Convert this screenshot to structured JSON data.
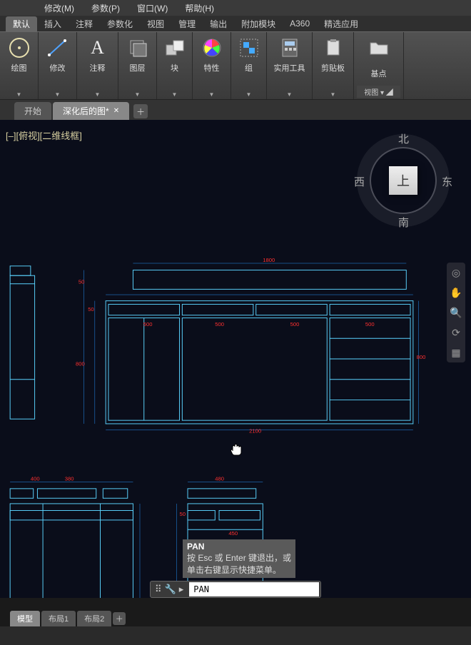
{
  "menu": {
    "items": [
      "修改(M)",
      "参数(P)",
      "窗口(W)",
      "帮助(H)"
    ]
  },
  "tabs": {
    "items": [
      "默认",
      "插入",
      "注释",
      "参数化",
      "视图",
      "管理",
      "输出",
      "附加模块",
      "A360",
      "精选应用"
    ],
    "active": 0
  },
  "panels": {
    "items": [
      {
        "label": "绘图",
        "icon": "circle"
      },
      {
        "label": "修改",
        "icon": "line"
      },
      {
        "label": "注释",
        "icon": "A"
      },
      {
        "label": "图层",
        "icon": "layers"
      },
      {
        "label": "块",
        "icon": "block"
      },
      {
        "label": "特性",
        "icon": "props"
      },
      {
        "label": "组",
        "icon": "group"
      },
      {
        "label": "实用工具",
        "icon": "calc"
      },
      {
        "label": "剪贴板",
        "icon": "clip"
      },
      {
        "label": "基点",
        "icon": "base"
      }
    ],
    "subview": "视图"
  },
  "filetabs": {
    "items": [
      "开始",
      "深化后的图*"
    ],
    "active": 1
  },
  "viewport": {
    "label": "[–][俯视][二维线框]"
  },
  "viewcube": {
    "n": "北",
    "s": "南",
    "e": "东",
    "w": "西",
    "top": "上"
  },
  "tooltip": {
    "title": "PAN",
    "line1": "按 Esc 或 Enter 键退出，或",
    "line2": "单击右键显示快捷菜单。"
  },
  "cmdline": {
    "value": "PAN"
  },
  "bottomtabs": {
    "items": [
      "模型",
      "布局1",
      "布局2"
    ],
    "active": 0
  }
}
